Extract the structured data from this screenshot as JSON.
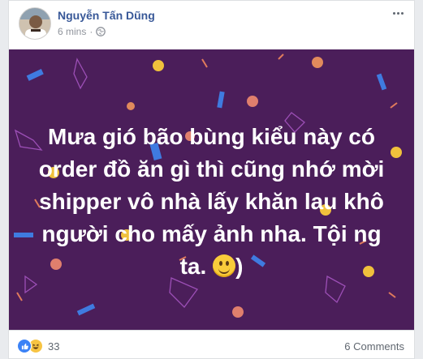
{
  "post": {
    "author": "Nguyễn Tấn Dũng",
    "time": "6 mins",
    "separator": "·",
    "privacy_icon": "globe-icon",
    "text_lines": [
      "Mưa gió bão bùng kiểu này có",
      "order đồ ăn gì thì cũng nhớ mời",
      "shipper vô nhà lấy khăn lau khô",
      "người cho mấy ảnh nha. Tội ng",
      "ta."
    ],
    "text_end": ")",
    "emoji": "smiling-face-icon",
    "background_color": "#4b1e5a"
  },
  "footer": {
    "reaction_icons": [
      "like-icon",
      "haha-icon"
    ],
    "reaction_count": "33",
    "comments": "6 Comments"
  },
  "colors": {
    "author": "#385898",
    "meta": "#90949c",
    "banner": "#4b1e5a",
    "like": "#3b82f6",
    "haha": "#f7c443"
  }
}
